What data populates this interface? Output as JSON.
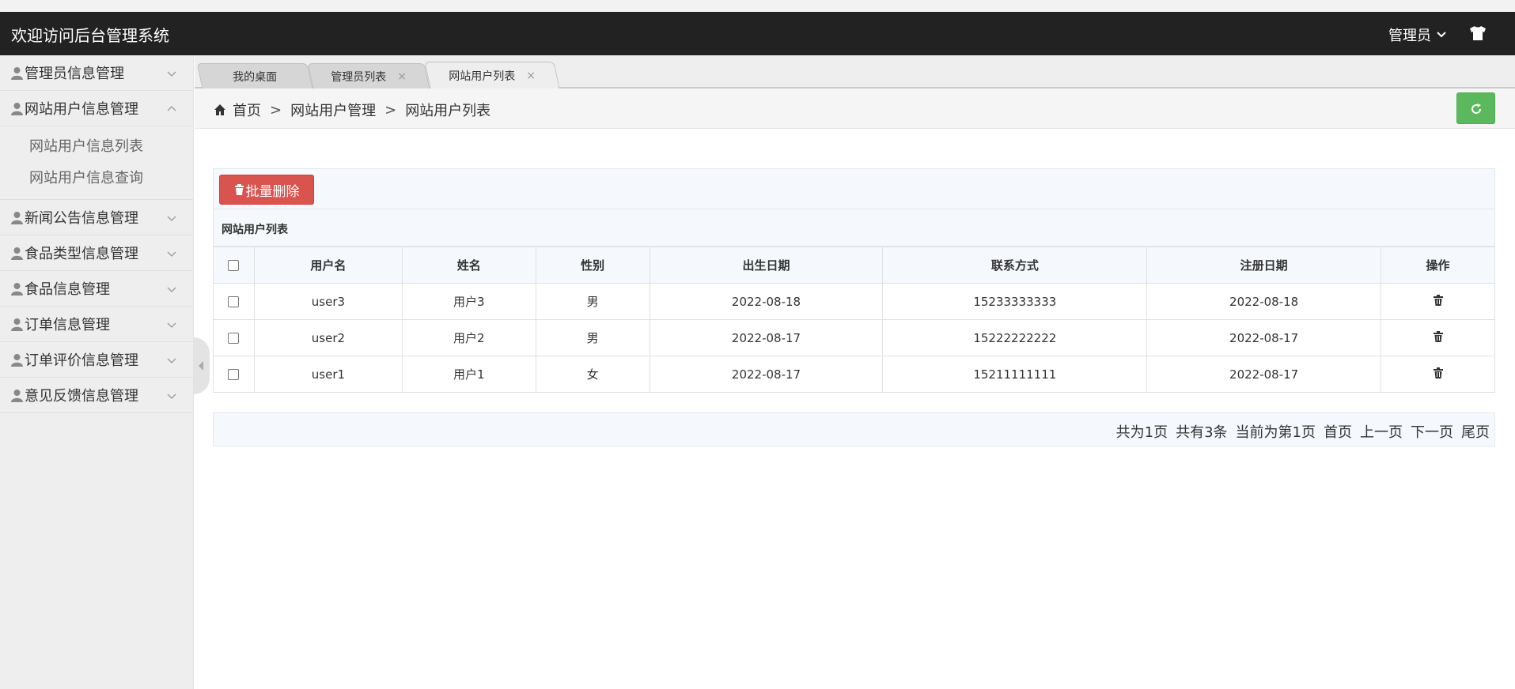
{
  "header": {
    "title": "欢迎访问后台管理系统",
    "user_label": "管理员"
  },
  "sidebar": {
    "items": [
      {
        "label": "管理员信息管理"
      },
      {
        "label": "网站用户信息管理",
        "expanded": true,
        "children": [
          {
            "label": "网站用户信息列表"
          },
          {
            "label": "网站用户信息查询"
          }
        ]
      },
      {
        "label": "新闻公告信息管理"
      },
      {
        "label": "食品类型信息管理"
      },
      {
        "label": "食品信息管理"
      },
      {
        "label": "订单信息管理"
      },
      {
        "label": "订单评价信息管理"
      },
      {
        "label": "意见反馈信息管理"
      }
    ]
  },
  "tabs": [
    {
      "label": "我的桌面",
      "closable": false
    },
    {
      "label": "管理员列表",
      "closable": true,
      "close": "×"
    },
    {
      "label": "网站用户列表",
      "closable": true,
      "active": true,
      "close": "×"
    }
  ],
  "breadcrumb": {
    "home": "首页",
    "sep": ">",
    "level1": "网站用户管理",
    "level2": "网站用户列表"
  },
  "toolbar": {
    "batch_delete": "批量删除"
  },
  "table": {
    "caption": "网站用户列表",
    "columns": [
      "用户名",
      "姓名",
      "性别",
      "出生日期",
      "联系方式",
      "注册日期",
      "操作"
    ],
    "rows": [
      {
        "username": "user3",
        "name": "用户3",
        "gender": "男",
        "birth": "2022-08-18",
        "phone": "15233333333",
        "registered": "2022-08-18"
      },
      {
        "username": "user2",
        "name": "用户2",
        "gender": "男",
        "birth": "2022-08-17",
        "phone": "15222222222",
        "registered": "2022-08-17"
      },
      {
        "username": "user1",
        "name": "用户1",
        "gender": "女",
        "birth": "2022-08-17",
        "phone": "15211111111",
        "registered": "2022-08-17"
      }
    ]
  },
  "pager": {
    "total_pages": "共为1页",
    "total_records": "共有3条",
    "current": "当前为第1页",
    "first": "首页",
    "prev": "上一页",
    "next": "下一页",
    "last": "尾页"
  },
  "colors": {
    "header_bg": "#222222",
    "danger": "#d9534f",
    "success": "#5cb85c"
  }
}
